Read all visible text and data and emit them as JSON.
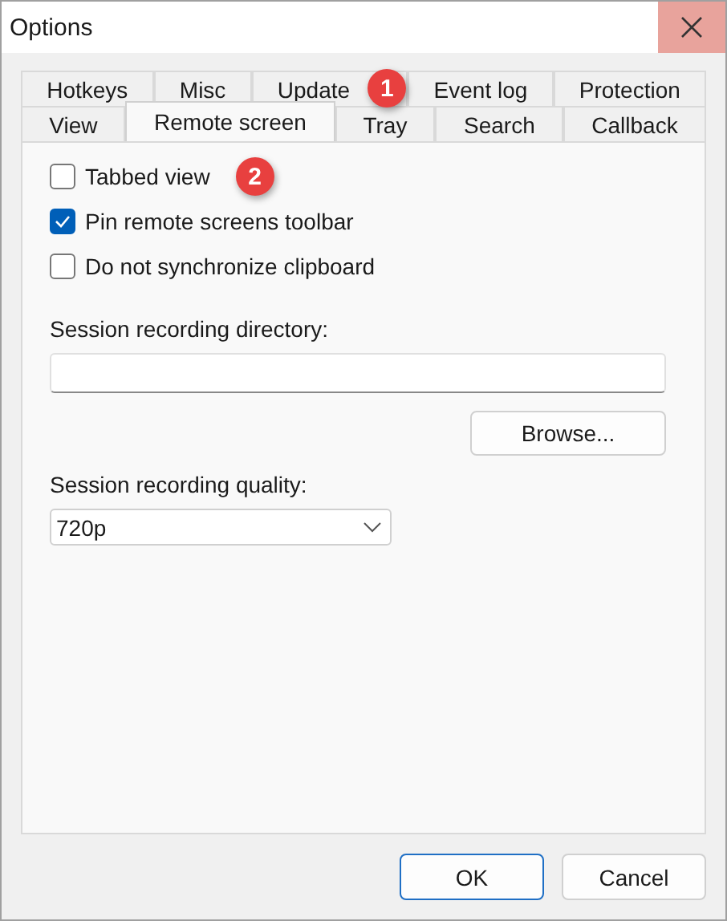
{
  "window": {
    "title": "Options"
  },
  "tab_rows": [
    [
      {
        "label": "Hotkeys",
        "selected": false
      },
      {
        "label": "Misc",
        "selected": false
      },
      {
        "label": "Update",
        "selected": false,
        "badge": "1"
      },
      {
        "label": "Event log",
        "selected": false
      },
      {
        "label": "Protection",
        "selected": false
      }
    ],
    [
      {
        "label": "View",
        "selected": false
      },
      {
        "label": "Remote screen",
        "selected": true
      },
      {
        "label": "Tray",
        "selected": false
      },
      {
        "label": "Search",
        "selected": false
      },
      {
        "label": "Callback",
        "selected": false
      }
    ]
  ],
  "options": [
    {
      "label": "Tabbed view",
      "checked": false,
      "badge": "2"
    },
    {
      "label": "Pin remote screens toolbar",
      "checked": true
    },
    {
      "label": "Do not synchronize clipboard",
      "checked": false
    }
  ],
  "directory": {
    "label": "Session recording directory:"
  },
  "browse_button": "Browse...",
  "quality": {
    "label": "Session recording quality:",
    "value": "720p"
  },
  "buttons": [
    {
      "label": "OK",
      "default": true
    },
    {
      "label": "Cancel",
      "default": false
    }
  ]
}
